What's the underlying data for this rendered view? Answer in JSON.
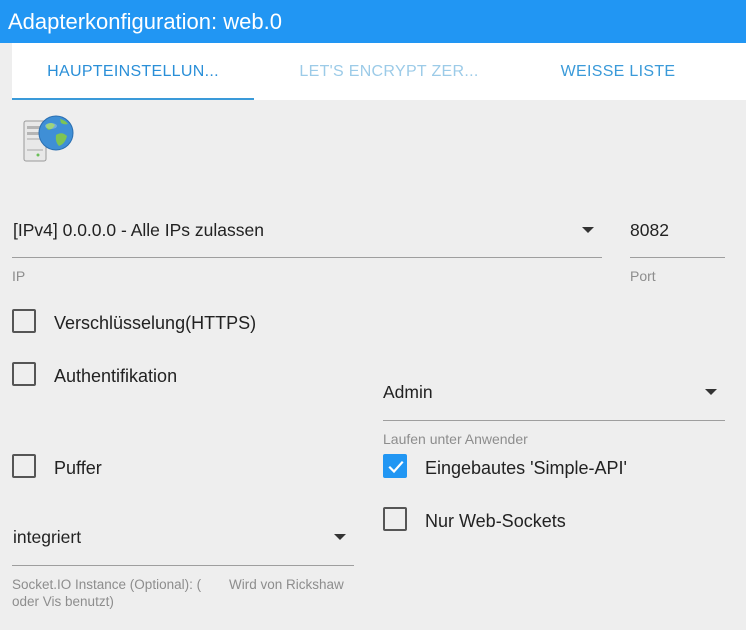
{
  "window": {
    "title": "Adapterkonfiguration: web.0"
  },
  "tabs": [
    {
      "label": "HAUPTEINSTELLUN..."
    },
    {
      "label": "LET'S ENCRYPT ZER..."
    },
    {
      "label": "WEISSE LISTE"
    }
  ],
  "logo": {
    "icon": "server-globe-icon"
  },
  "ip": {
    "value": "[IPv4] 0.0.0.0 - Alle IPs zulassen",
    "caption": "IP"
  },
  "port": {
    "value": "8082",
    "caption": "Port"
  },
  "https": {
    "label": "Verschlüsselung(HTTPS)",
    "checked": false
  },
  "auth": {
    "label": "Authentifikation",
    "checked": false
  },
  "run_as": {
    "value": "Admin",
    "caption": "Laufen unter Anwender"
  },
  "cache": {
    "label": "Puffer",
    "checked": false
  },
  "simple_api": {
    "label": "Eingebautes 'Simple-API'",
    "checked": true
  },
  "websockets_only": {
    "label": "Nur Web-Sockets",
    "checked": false
  },
  "socketio": {
    "value": "integriert",
    "caption_line1": "Socket.IO Instance (Optional): (",
    "caption_extra": "Wird von Rickshaw",
    "caption_line2": "oder Vis benutzt)"
  },
  "colors": {
    "accent": "#2196f3",
    "tab_active": "#2a8fd8",
    "background": "#eeeeee"
  }
}
